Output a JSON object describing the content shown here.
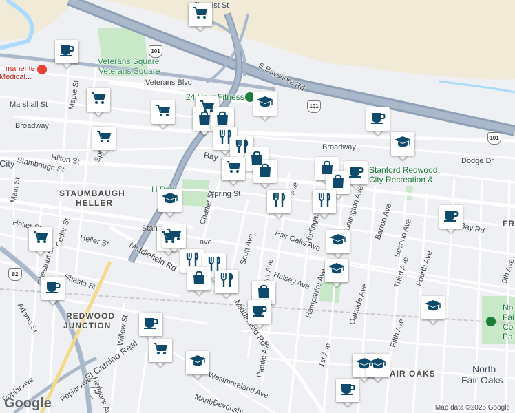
{
  "labels": {
    "bayshore": "E Bayshore Rd",
    "veterans_square": "Veterans Square",
    "veterans_blvd": "Veterans Blvd",
    "marshall": "Marshall St",
    "maple": "Maple St",
    "broadway_w": "Broadway",
    "broadway_e": "Broadway",
    "hilton": "Hilton St",
    "stambaugh_st": "Stambaugh St",
    "spring_w": "Spring St",
    "spring_e": "Spring St",
    "city": "City",
    "main": "Main St",
    "staumbaugh": "STAUMBAUGH",
    "heller_area": "HELLER",
    "heller_st": "Heller St",
    "heller_st2": "Heller St",
    "cedar": "Cedar St",
    "chestnut": "Chestnut St",
    "shasta": "Shasta St",
    "adams": "Adams St",
    "redwood_junction_1": "REDWOOD",
    "redwood_junction_2": "JUNCTION",
    "willow": "Willow St",
    "el_camino": "El Camino Real",
    "poplar": "Poplar Ave",
    "hemlock": "Hemlock Ave",
    "charter": "Charter St",
    "middlefield_w": "Middlefield Rd",
    "middlefield_s": "Middlefield Rd",
    "scott": "Scott Ave",
    "macarthur": "MacArthur Ave",
    "halsey": "Halsey Ave",
    "fair_oaks_ave": "Fair Oaks Ave",
    "hurlingame": "Hurlingame Ave",
    "huntington": "Huntington Ave",
    "barron": "Barron Ave",
    "second": "Second Ave",
    "third": "Third Ave",
    "fourth": "Fourth Ave",
    "fifth": "Fifth Ave",
    "ninth": "9th Ave",
    "bay_rd": "Bay Rd",
    "bay_w": "Bay",
    "dodge": "Dodge Dr",
    "hampshire": "Hampshire Ave",
    "oakside": "Oakside Ave",
    "first": "1st Ave",
    "pacific": "Pacific Ave",
    "westmoreland": "Westmoreland Ave",
    "marlborough": "Marlbo",
    "devonshire": "Devonshi",
    "fair_oaks_area": "FAIR OAKS",
    "north_fair_oaks_1": "North",
    "north_fair_oaks_2": "Fair Oaks",
    "hosp_1": "manente",
    "hosp_2": "Medical...",
    "fitness": "24 Hour Fitness",
    "stanford_1": "Stanford Redwood",
    "stanford_2": "City Recreation &...",
    "park_partial": "H     Park",
    "nfo_1": "No",
    "nfo_2": "Fai",
    "nfo_3": "Co",
    "nfo_4": "Pa",
    "fr": "FR",
    "ave_frag": "Ave",
    "stan_frag": "Stan",
    "ave_frag2": "ave",
    "fair_oaks_frag": "AIR OAKS",
    "ellinquist": "ellinquist St"
  },
  "shields": {
    "us101_a": "101",
    "us101_b": "101",
    "us101_c": "101",
    "ca82": "82",
    "ca84": "84"
  },
  "colors": {
    "marker_fill": "#0d4a6b",
    "park_green": "#c9e8c8",
    "freeway": "#8f9fb5",
    "water": "#aadaff",
    "industrial": "#f1ead7"
  },
  "markers": [
    {
      "icon": "cart"
    },
    {
      "icon": "cup"
    },
    {
      "icon": "cart"
    },
    {
      "icon": "cart"
    },
    {
      "icon": "cart"
    },
    {
      "icon": "cart"
    },
    {
      "icon": "bag"
    },
    {
      "icon": "bag"
    },
    {
      "icon": "school"
    },
    {
      "icon": "fork"
    },
    {
      "icon": "fork"
    },
    {
      "icon": "bag"
    },
    {
      "icon": "cart"
    },
    {
      "icon": "bag"
    },
    {
      "icon": "cup"
    },
    {
      "icon": "school"
    },
    {
      "icon": "bag"
    },
    {
      "icon": "bag"
    },
    {
      "icon": "cup"
    },
    {
      "icon": "fork"
    },
    {
      "icon": "fork"
    },
    {
      "icon": "school"
    },
    {
      "icon": "cart"
    },
    {
      "icon": "cart"
    },
    {
      "icon": "cup"
    },
    {
      "icon": "fork"
    },
    {
      "icon": "fork"
    },
    {
      "icon": "bag"
    },
    {
      "icon": "fork"
    },
    {
      "icon": "bag"
    },
    {
      "icon": "cup"
    },
    {
      "icon": "school"
    },
    {
      "icon": "school"
    },
    {
      "icon": "school"
    },
    {
      "icon": "cup"
    },
    {
      "icon": "cart"
    },
    {
      "icon": "school"
    },
    {
      "icon": "school"
    },
    {
      "icon": "school"
    },
    {
      "icon": "cup"
    },
    {
      "icon": "cup"
    },
    {
      "icon": "cart"
    }
  ],
  "attribution": {
    "logo": "Google",
    "credit": "Map data ©2025 Google"
  }
}
